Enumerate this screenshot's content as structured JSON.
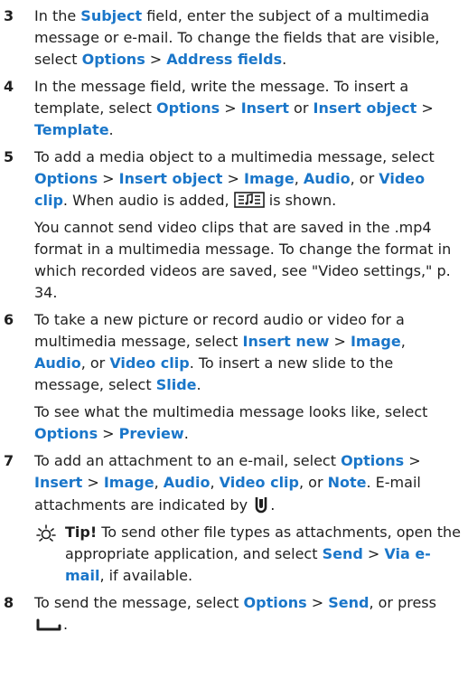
{
  "steps": [
    {
      "number": "3",
      "paragraphs": [
        [
          {
            "t": "In the "
          },
          {
            "k": "Subject"
          },
          {
            "t": " field, enter the subject of a multimedia message or e-mail. To change the fields that are visible, select "
          },
          {
            "k": "Options"
          },
          {
            "t": " > "
          },
          {
            "k": "Address fields"
          },
          {
            "t": "."
          }
        ]
      ]
    },
    {
      "number": "4",
      "paragraphs": [
        [
          {
            "t": "In the message field, write the message. To insert a template, select "
          },
          {
            "k": "Options"
          },
          {
            "t": " > "
          },
          {
            "k": "Insert"
          },
          {
            "t": " or "
          },
          {
            "k": "Insert object"
          },
          {
            "t": " > "
          },
          {
            "k": "Template"
          },
          {
            "t": "."
          }
        ]
      ]
    },
    {
      "number": "5",
      "paragraphs": [
        [
          {
            "t": "To add a media object to a multimedia message, select "
          },
          {
            "k": "Options"
          },
          {
            "t": " > "
          },
          {
            "k": "Insert object"
          },
          {
            "t": " > "
          },
          {
            "k": "Image"
          },
          {
            "t": ", "
          },
          {
            "k": "Audio"
          },
          {
            "t": ", or "
          },
          {
            "k": "Video clip"
          },
          {
            "t": ". When audio is added, "
          },
          {
            "i": "audio-icon"
          },
          {
            "t": " is shown."
          }
        ],
        [
          {
            "t": "You cannot send video clips that are saved in the .mp4 format in a multimedia message. To change the format in which recorded videos are saved, see \"Video settings,\" p. 34."
          }
        ]
      ]
    },
    {
      "number": "6",
      "paragraphs": [
        [
          {
            "t": "To take a new picture or record audio or video for a multimedia message, select "
          },
          {
            "k": "Insert new"
          },
          {
            "t": " > "
          },
          {
            "k": "Image"
          },
          {
            "t": ", "
          },
          {
            "k": "Audio"
          },
          {
            "t": ", or "
          },
          {
            "k": "Video clip"
          },
          {
            "t": ". To insert a new slide to the message, select "
          },
          {
            "k": "Slide"
          },
          {
            "t": "."
          }
        ],
        [
          {
            "t": "To see what the multimedia message looks like, select "
          },
          {
            "k": "Options"
          },
          {
            "t": " > "
          },
          {
            "k": "Preview"
          },
          {
            "t": "."
          }
        ]
      ]
    },
    {
      "number": "7",
      "paragraphs": [
        [
          {
            "t": "To add an attachment to an e-mail, select "
          },
          {
            "k": "Options"
          },
          {
            "t": " > "
          },
          {
            "k": "Insert"
          },
          {
            "t": " > "
          },
          {
            "k": "Image"
          },
          {
            "t": ", "
          },
          {
            "k": "Audio"
          },
          {
            "t": ", "
          },
          {
            "k": "Video clip"
          },
          {
            "t": ", or "
          },
          {
            "k": "Note"
          },
          {
            "t": ". E-mail attachments are indicated by "
          },
          {
            "i": "attachment-icon"
          },
          {
            "t": "."
          }
        ]
      ],
      "tip": {
        "label": "Tip!",
        "icon": "tip-icon",
        "segments": [
          {
            "t": " To send other file types as attachments, open the appropriate application, and select "
          },
          {
            "k": "Send"
          },
          {
            "t": " > "
          },
          {
            "k": "Via e-mail"
          },
          {
            "t": ", if available."
          }
        ]
      }
    },
    {
      "number": "8",
      "paragraphs": [
        [
          {
            "t": "To send the message, select "
          },
          {
            "k": "Options"
          },
          {
            "t": " > "
          },
          {
            "k": "Send"
          },
          {
            "t": ", or press "
          },
          {
            "i": "call-key-icon"
          },
          {
            "t": "."
          }
        ]
      ]
    }
  ],
  "colors": {
    "keyword": "#1a76c9",
    "text": "#1f1f1f",
    "tip_icon": "#1a76c9"
  }
}
